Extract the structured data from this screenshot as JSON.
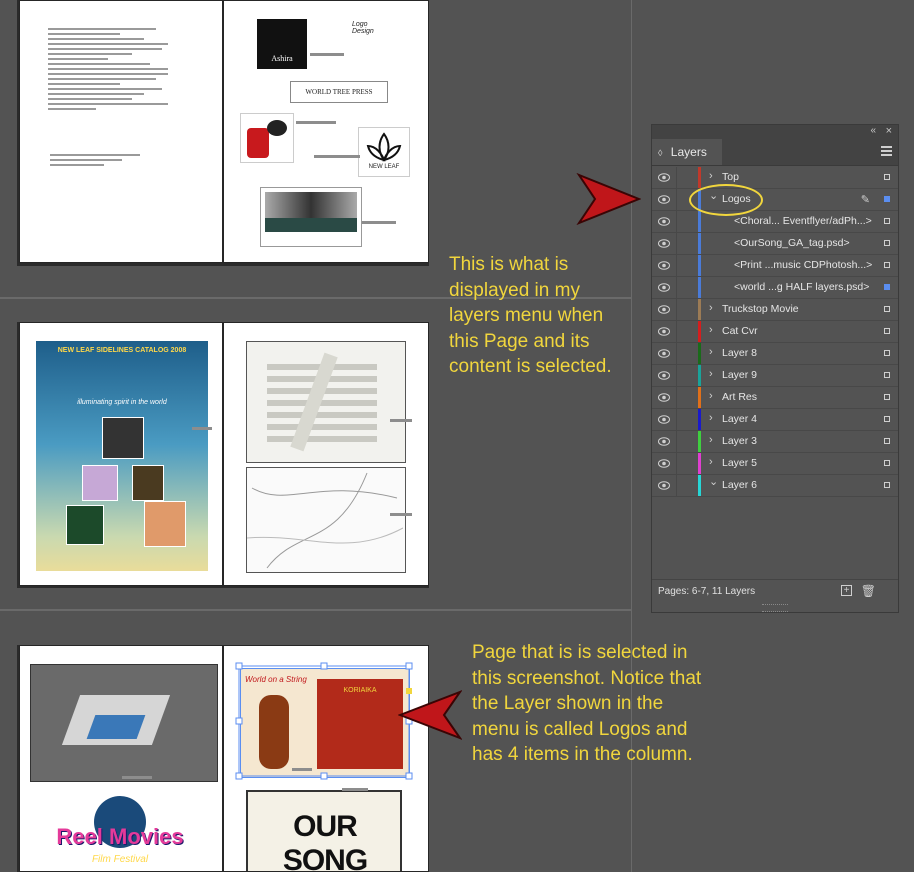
{
  "callouts": {
    "top": "This is what is displayed in my layers menu when this Page and its content is selected.",
    "bottom": "Page that is is selected in this screenshot. Notice that the Layer shown in the menu is called Logos and has 4 items in the column."
  },
  "callout_lines": {
    "top": [
      "This is what is",
      "displayed in my",
      "layers menu when",
      "this Page and its",
      "content is selected."
    ],
    "bottom": [
      "Page that is is selected in",
      "this screenshot. Notice that",
      "the Layer shown in the",
      "menu is called Logos and",
      "has 4 items in the column."
    ]
  },
  "colors": {
    "callout_text": "#f1d63d",
    "arrow": "#c0161a",
    "selection": "#5b8ef0"
  },
  "layers_panel": {
    "title": "Layers",
    "rows": [
      {
        "label": "Top",
        "type": "layer",
        "expanded": false,
        "color": "#c0392b"
      },
      {
        "label": "Logos",
        "type": "layer",
        "expanded": true,
        "color": "#4a7bd8"
      },
      {
        "label": "<Choral... Eventflyer/adPh...>",
        "type": "item",
        "color": "#4a7bd8"
      },
      {
        "label": "<OurSong_GA_tag.psd>",
        "type": "item",
        "color": "#4a7bd8"
      },
      {
        "label": "<Print ...music CDPhotosh...>",
        "type": "item",
        "color": "#4a7bd8"
      },
      {
        "label": "<world ...g HALF layers.psd>",
        "type": "item",
        "color": "#4a7bd8"
      },
      {
        "label": "Truckstop Movie",
        "type": "layer",
        "expanded": false,
        "color": "#9c7b55"
      },
      {
        "label": "Cat Cvr",
        "type": "layer",
        "expanded": false,
        "color": "#d41e1e"
      },
      {
        "label": "Layer 8",
        "type": "layer",
        "expanded": false,
        "color": "#1a6b1a"
      },
      {
        "label": "Layer 9",
        "type": "layer",
        "expanded": false,
        "color": "#1aa39a"
      },
      {
        "label": "Art Res",
        "type": "layer",
        "expanded": false,
        "color": "#e0701a"
      },
      {
        "label": "Layer 4",
        "type": "layer",
        "expanded": false,
        "color": "#1a1acb"
      },
      {
        "label": "Layer 3",
        "type": "layer",
        "expanded": false,
        "color": "#3fcf3f"
      },
      {
        "label": "Layer 5",
        "type": "layer",
        "expanded": false,
        "color": "#e03fd0"
      },
      {
        "label": "Layer 6",
        "type": "layer",
        "expanded": true,
        "color": "#27d6d6"
      }
    ],
    "footer_info": "Pages: 6-7, 11 Layers"
  },
  "pages": {
    "logo_texts": [
      "Logo Design",
      "Ashira",
      "WORLD TREE PRESS",
      "NEW LEAF"
    ],
    "catalog_title": "NEW LEAF SIDELINES CATALOG 2008",
    "catalog_subtitle": "illuminating spirit in the world",
    "reel_movies": "Reel Movies",
    "film_festival": "Film Festival",
    "our_song": "OUR SONG",
    "koriaika": "KORIAIKA",
    "world_on_a_string": "World on a String"
  }
}
